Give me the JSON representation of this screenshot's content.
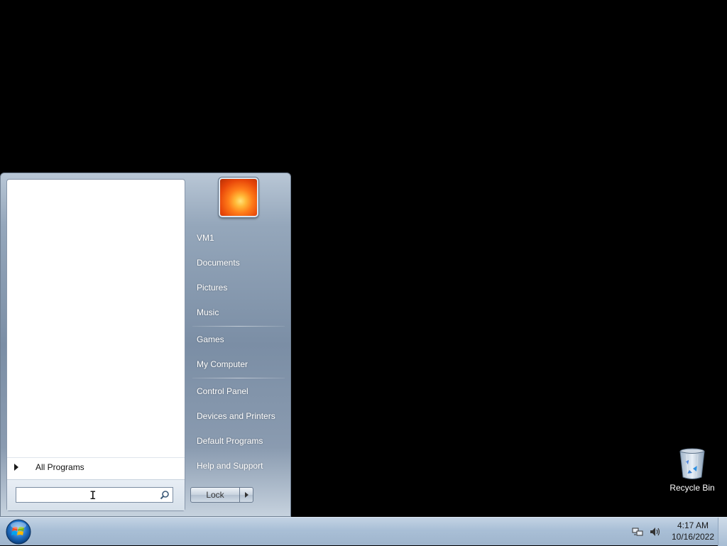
{
  "desktop": {
    "icons": [
      {
        "label": "Recycle Bin",
        "icon": "recycle-bin-icon"
      }
    ]
  },
  "start_menu": {
    "all_programs_label": "All Programs",
    "search": {
      "value": "",
      "placeholder": ""
    },
    "user_picture": "flower-avatar",
    "right_items": [
      {
        "label": "VM1"
      },
      {
        "label": "Documents"
      },
      {
        "label": "Pictures"
      },
      {
        "label": "Music"
      },
      {
        "label": "Games"
      },
      {
        "label": "My Computer"
      },
      {
        "label": "Control Panel"
      },
      {
        "label": "Devices and Printers"
      },
      {
        "label": "Default Programs"
      },
      {
        "label": "Help and Support"
      }
    ],
    "power_button_label": "Lock"
  },
  "taskbar": {
    "start_button_icon": "windows-orb-icon",
    "tray_icons": [
      "network-icon",
      "volume-icon"
    ],
    "clock_time": "4:17 AM",
    "clock_date": "10/16/2022"
  }
}
